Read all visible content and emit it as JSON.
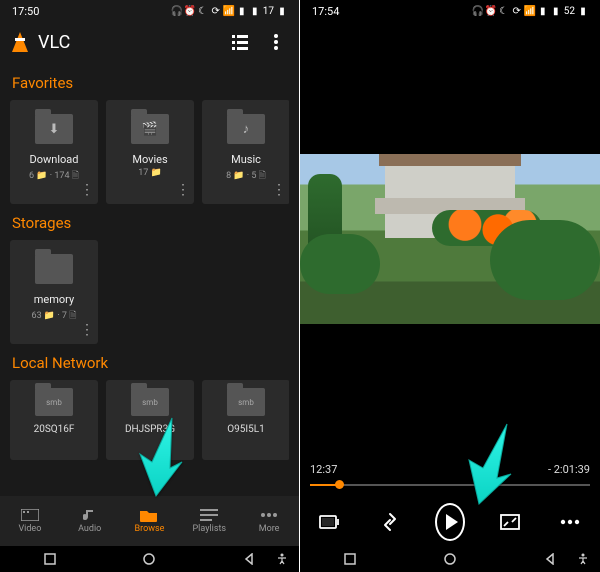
{
  "left": {
    "status_time": "17:50",
    "battery": "17",
    "app_title": "VLC",
    "sections": {
      "favorites_title": "Favorites",
      "storages_title": "Storages",
      "network_title": "Local Network"
    },
    "favorites": [
      {
        "label": "Download",
        "meta": "6 📁 · 174 🗎",
        "glyph": "⬇"
      },
      {
        "label": "Movies",
        "meta": "17 📁",
        "glyph": "🎬"
      },
      {
        "label": "Music",
        "meta": "8 📁 · 5 🗎",
        "glyph": "♪"
      }
    ],
    "storages": [
      {
        "label": "memory",
        "meta": "63 📁 · 7 🗎"
      }
    ],
    "network": [
      {
        "label": "20SQ16F",
        "proto": "smb"
      },
      {
        "label": "DHJSPR3G",
        "proto": "smb"
      },
      {
        "label": "O95I5L1",
        "proto": "smb"
      }
    ],
    "nav": {
      "video": "Video",
      "audio": "Audio",
      "browse": "Browse",
      "playlists": "Playlists",
      "more": "More"
    }
  },
  "right": {
    "status_time": "17:54",
    "battery": "52",
    "elapsed": "12:37",
    "remaining": "- 2:01:39"
  }
}
